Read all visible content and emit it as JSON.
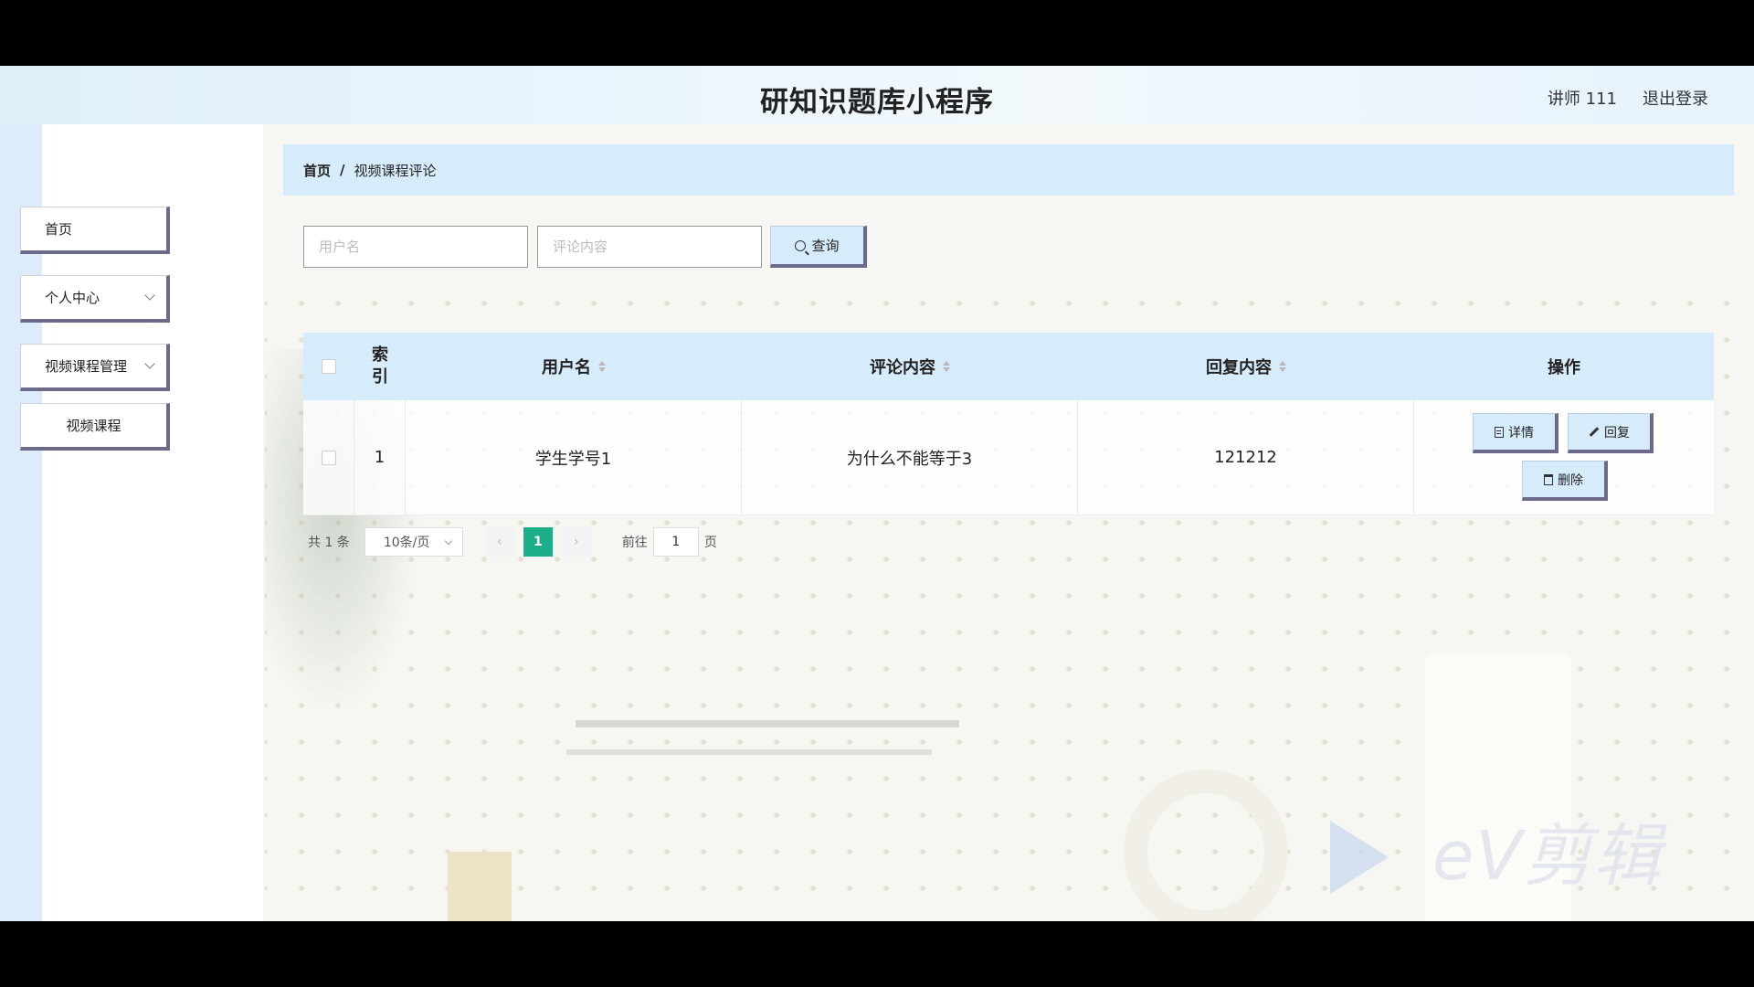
{
  "header": {
    "app_title": "研知识题库小程序",
    "user": "讲师 111",
    "logout": "退出登录"
  },
  "sidebar": {
    "items": [
      {
        "label": "首页"
      },
      {
        "label": "个人中心"
      },
      {
        "label": "视频课程管理"
      },
      {
        "label": "视频课程"
      }
    ]
  },
  "breadcrumb": {
    "home": "首页",
    "separator": "/",
    "current": "视频课程评论"
  },
  "search": {
    "username_placeholder": "用户名",
    "comment_placeholder": "评论内容",
    "button_label": "查询"
  },
  "table": {
    "headers": {
      "index": "索引",
      "username": "用户名",
      "comment": "评论内容",
      "reply": "回复内容",
      "actions": "操作"
    },
    "rows": [
      {
        "index": "1",
        "username": "学生学号1",
        "comment": "为什么不能等于3",
        "reply": "121212"
      }
    ],
    "actions": {
      "detail": "详情",
      "reply": "回复",
      "delete": "删除"
    }
  },
  "pagination": {
    "total": "共 1 条",
    "page_size": "10条/页",
    "current_page": "1",
    "goto_label": "前往",
    "goto_value": "1",
    "page_suffix": "页"
  },
  "watermark": "eV剪辑",
  "colors": {
    "accent": "#1aae89",
    "header_bg": "#d7ecfb",
    "button_shadow": "#6c6a8a"
  }
}
